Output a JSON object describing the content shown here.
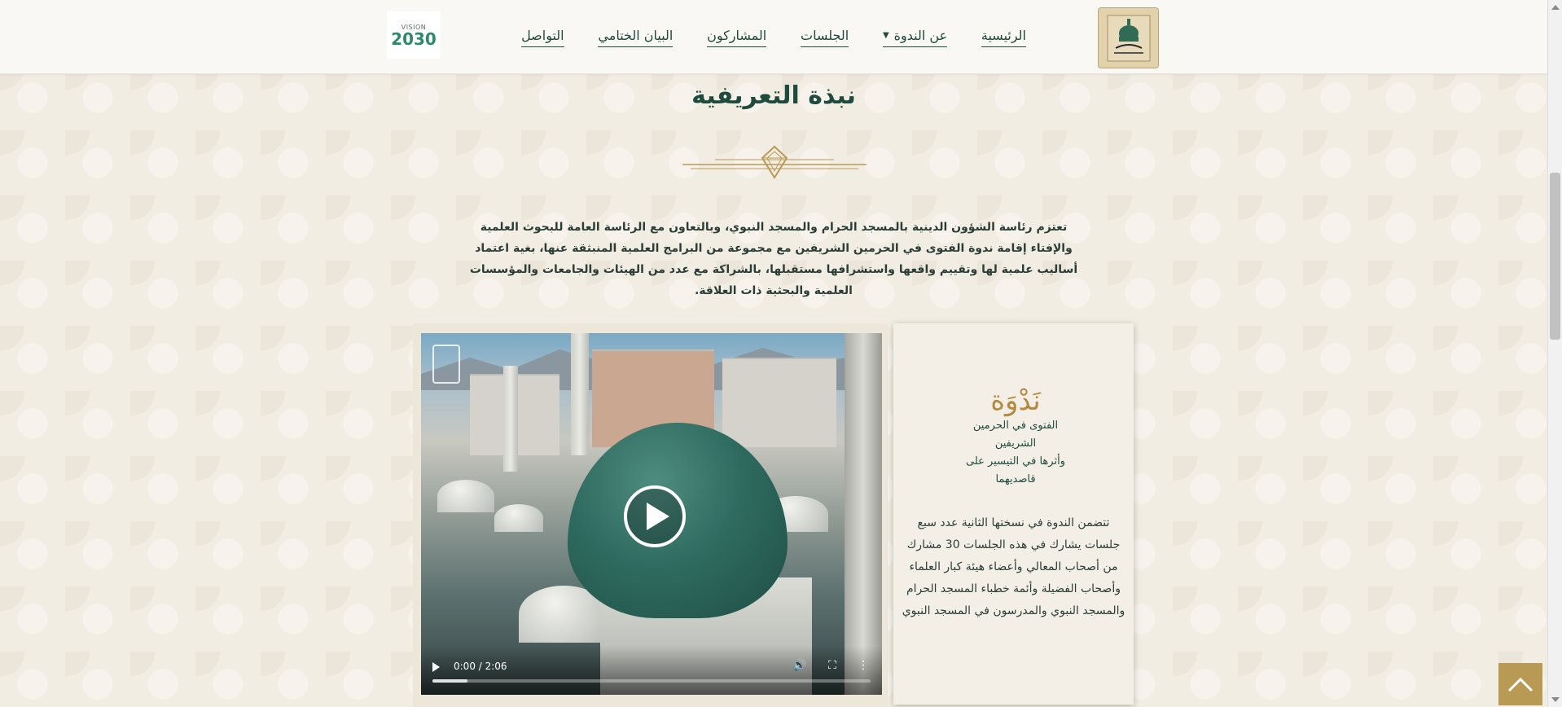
{
  "header": {
    "nav": [
      {
        "label": "الرئيسية"
      },
      {
        "label": "عن الندوة",
        "has_dropdown": true
      },
      {
        "label": "الجلسات"
      },
      {
        "label": "المشاركون"
      },
      {
        "label": "البيان الختامي"
      },
      {
        "label": "التواصل"
      }
    ],
    "vision_logo": {
      "top": "VISION",
      "year": "2030"
    }
  },
  "intro": {
    "title": "نبذة التعريفية",
    "text": "تعتزم رئاسة الشؤون الدينية بالمسجد الحرام والمسجد النبوي، وبالتعاون مع الرئاسة العامة للبحوث العلمية والإفتاء إقامة ندوة الفتوى في الحرمين الشريفين مع مجموعة من البرامج العلمية المنبثقة عنها، بغية اعتماد أساليب علمية لها وتقييم واقعها واستشرافها مستقبلها، بالشراكة مع عدد من الهيئات والجامعات والمؤسسات العلمية والبحثية ذات العلاقة."
  },
  "video": {
    "time": "0:00 / 2:06",
    "progress_buffered": 0.08
  },
  "card": {
    "calligraphy": {
      "title": "نَدْوَة",
      "line1": "الفتوى في الحرمين الشريفين",
      "line2": "وأثرها في التيسير على قاصديهما"
    },
    "text": "تتضمن الندوة في نسختها الثانية عدد سبع جلسات يشارك في هذه الجلسات 30 مشارك من أصحاب المعالي وأعضاء هيئة كبار العلماء وأصحاب الفضيلة وأئمة خطباء المسجد الحرام والمسجد النبوي والمدرسون في المسجد النبوي"
  },
  "colors": {
    "accent_green": "#1f4a3e",
    "gold": "#b99a55",
    "background": "#f2ede2"
  },
  "icons": {
    "play": "play-icon",
    "volume": "volume-icon",
    "fullscreen": "fullscreen-icon",
    "more": "more-options-icon",
    "back_to_top": "arrow-up-icon"
  }
}
